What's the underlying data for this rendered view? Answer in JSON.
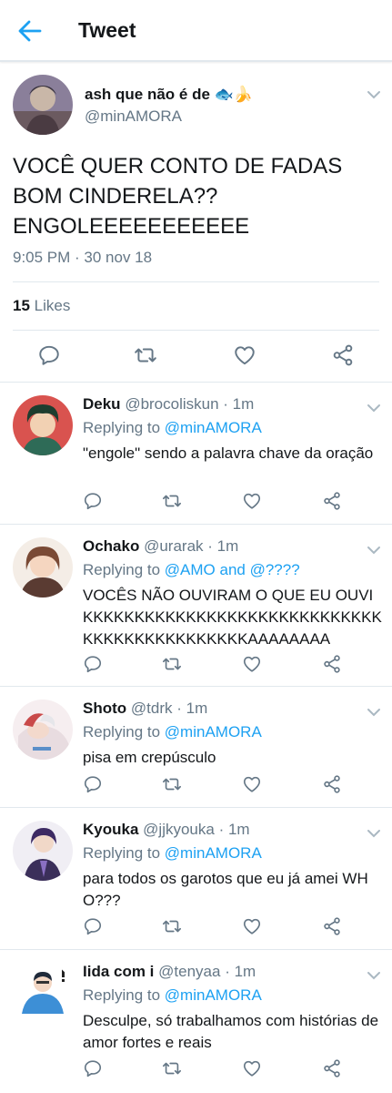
{
  "header": {
    "title": "Tweet",
    "back_icon": "arrow-left-icon",
    "accent": "#1da1f2"
  },
  "tweet": {
    "author": "ash que não é de 🐟🍌",
    "handle": "@minAMORA",
    "text": "VOCÊ QUER CONTO DE FADAS BOM CINDERELA?? ENGOLEEEEEEEEEEE",
    "time": "9:05 PM · 30 nov 18",
    "likes_count": "15",
    "likes_label": "Likes"
  },
  "replies": [
    {
      "name": "Deku",
      "handle": "@brocoliskun",
      "age": "· 1m",
      "replying_prefix": "Replying to",
      "replying_to": "@minAMORA",
      "text": "\"engole\" sendo a palavra chave da oração"
    },
    {
      "name": "Ochako",
      "handle": "@urarak",
      "age": "· 1m",
      "replying_prefix": "Replying to",
      "replying_to": "@AMO and @????",
      "text": "VOCÊS NÃO OUVIRAM O QUE EU OUVI KKKKKKKKKKKKKKKKKKKKKKKKKKKKKKKKKKKKKKKKKKKKKAAAAAAAA"
    },
    {
      "name": "Shoto",
      "handle": "@tdrk",
      "age": "· 1m",
      "replying_prefix": "Replying to",
      "replying_to": "@minAMORA",
      "text": "pisa em crepúsculo"
    },
    {
      "name": "Kyouka",
      "handle": "@jjkyouka",
      "age": "· 1m",
      "replying_prefix": "Replying to",
      "replying_to": "@minAMORA",
      "text": "para todos os garotos que eu já amei WHO???"
    },
    {
      "name": "Iida com i",
      "handle": "@tenyaa",
      "age": "· 1m",
      "replying_prefix": "Replying to",
      "replying_to": "@minAMORA",
      "text": "Desculpe, só trabalhamos com histórias de amor fortes e reais"
    }
  ],
  "icons": [
    "reply-icon",
    "retweet-icon",
    "like-icon",
    "share-icon",
    "chevron-down-icon"
  ]
}
